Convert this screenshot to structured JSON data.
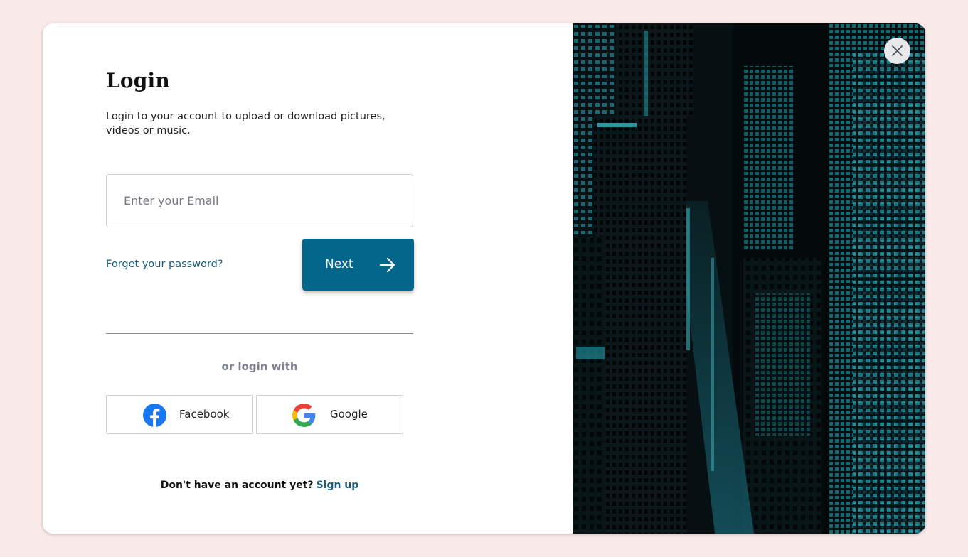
{
  "login": {
    "title": "Login",
    "subtitle": "Login to your account to upload or download pictures, videos or music.",
    "email_placeholder": "Enter your Email",
    "forgot_label": "Forget your password?",
    "next_label": "Next",
    "or_label": "or login with",
    "facebook_label": "Facebook",
    "google_label": "Google",
    "signup_prompt": "Don't have an account yet?",
    "signup_link": "Sign up"
  },
  "colors": {
    "page_background": "#f9e9e8",
    "primary": "#03668a",
    "link": "#1d5b7b",
    "facebook": "#1877f2",
    "building_light": "#2ad0df"
  },
  "icons": {
    "close": "close-icon",
    "next": "arrow-right-icon",
    "facebook": "facebook-logo-icon",
    "google": "google-logo-icon"
  }
}
